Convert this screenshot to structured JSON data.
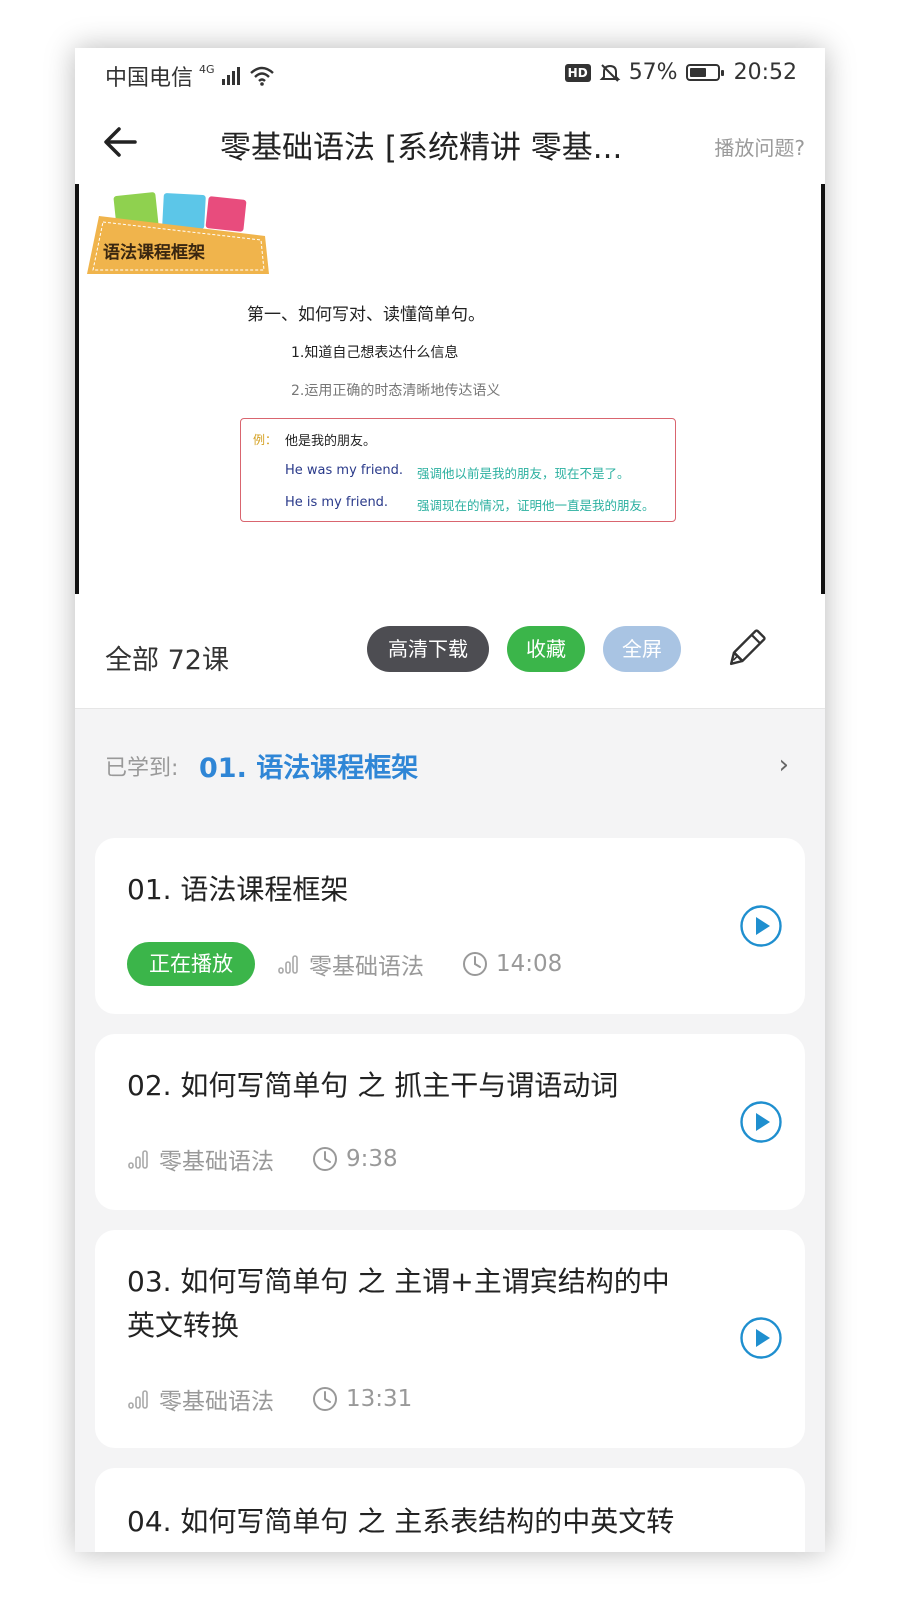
{
  "status_bar": {
    "carrier": "中国电信",
    "network": "4G",
    "hd": "HD",
    "battery": "57%",
    "time": "20:52"
  },
  "header": {
    "title": "零基础语法 [系统精讲 零基...",
    "play_issue": "播放问题?"
  },
  "video": {
    "banner_label": "语法课程框架",
    "heading": "第一、如何写对、读懂简单句。",
    "point1": "1.知道自己想表达什么信息",
    "point2": "2.运用正确的时态清晰地传达语义",
    "example": {
      "tag": "例：",
      "chinese": "他是我的朋友。",
      "en1": "He was my friend.",
      "note1": "强调他以前是我的朋友，现在不是了。",
      "en2": "He is my friend.",
      "note2": "强调现在的情况，证明他一直是我的朋友。"
    }
  },
  "actions": {
    "all_label": "全部 72课",
    "download": "高清下载",
    "favorite": "收藏",
    "fullscreen": "全屏",
    "colors": {
      "download": "#4d4d52",
      "favorite": "#3bb54a",
      "fullscreen": "#a9c4e3"
    }
  },
  "learned": {
    "label": "已学到:",
    "value": "01. 语法课程框架"
  },
  "lessons": [
    {
      "title": "01. 语法课程框架",
      "badge": "正在播放",
      "category": "零基础语法",
      "duration": "14:08"
    },
    {
      "title": "02. 如何写简单句 之 抓主干与谓语动词",
      "category": "零基础语法",
      "duration": "9:38"
    },
    {
      "title": "03. 如何写简单句 之 主谓+主谓宾结构的中英文转换",
      "category": "零基础语法",
      "duration": "13:31"
    },
    {
      "title": "04. 如何写简单句 之 主系表结构的中英文转"
    }
  ],
  "accent_color": "#2f86d6"
}
